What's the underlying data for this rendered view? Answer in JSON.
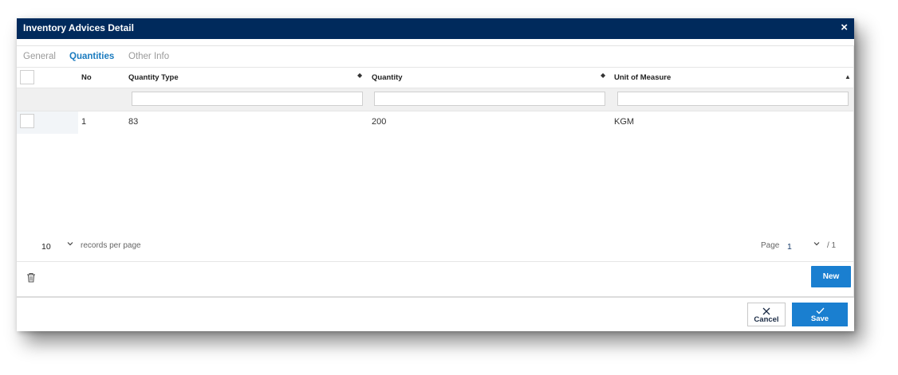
{
  "dialog": {
    "title": "Inventory Advices Detail",
    "close_icon": "×"
  },
  "tabs": [
    {
      "label": "General",
      "active": false
    },
    {
      "label": "Quantities",
      "active": true
    },
    {
      "label": "Other Info",
      "active": false
    }
  ],
  "grid": {
    "columns": [
      "No",
      "Quantity Type",
      "Quantity",
      "Unit of Measure"
    ],
    "sort_icons": {
      "both": "◆",
      "asc": "▲"
    },
    "filters": {
      "quantity_type": "",
      "quantity": "",
      "unit_of_measure": ""
    },
    "rows": [
      {
        "no": "1",
        "quantity_type": "83",
        "quantity": "200",
        "unit_of_measure": "KGM"
      }
    ]
  },
  "pager": {
    "records_per_page_value": "10",
    "records_per_page_text": "records per page",
    "page_label": "Page",
    "page_value": "1",
    "page_total": "/ 1"
  },
  "toolbar": {
    "new_label": "New"
  },
  "footer": {
    "cancel_label": "Cancel",
    "save_label": "Save"
  },
  "colors": {
    "titlebar": "#002a5c",
    "accent": "#1a7fd0",
    "active_tab": "#1a7bbf"
  }
}
